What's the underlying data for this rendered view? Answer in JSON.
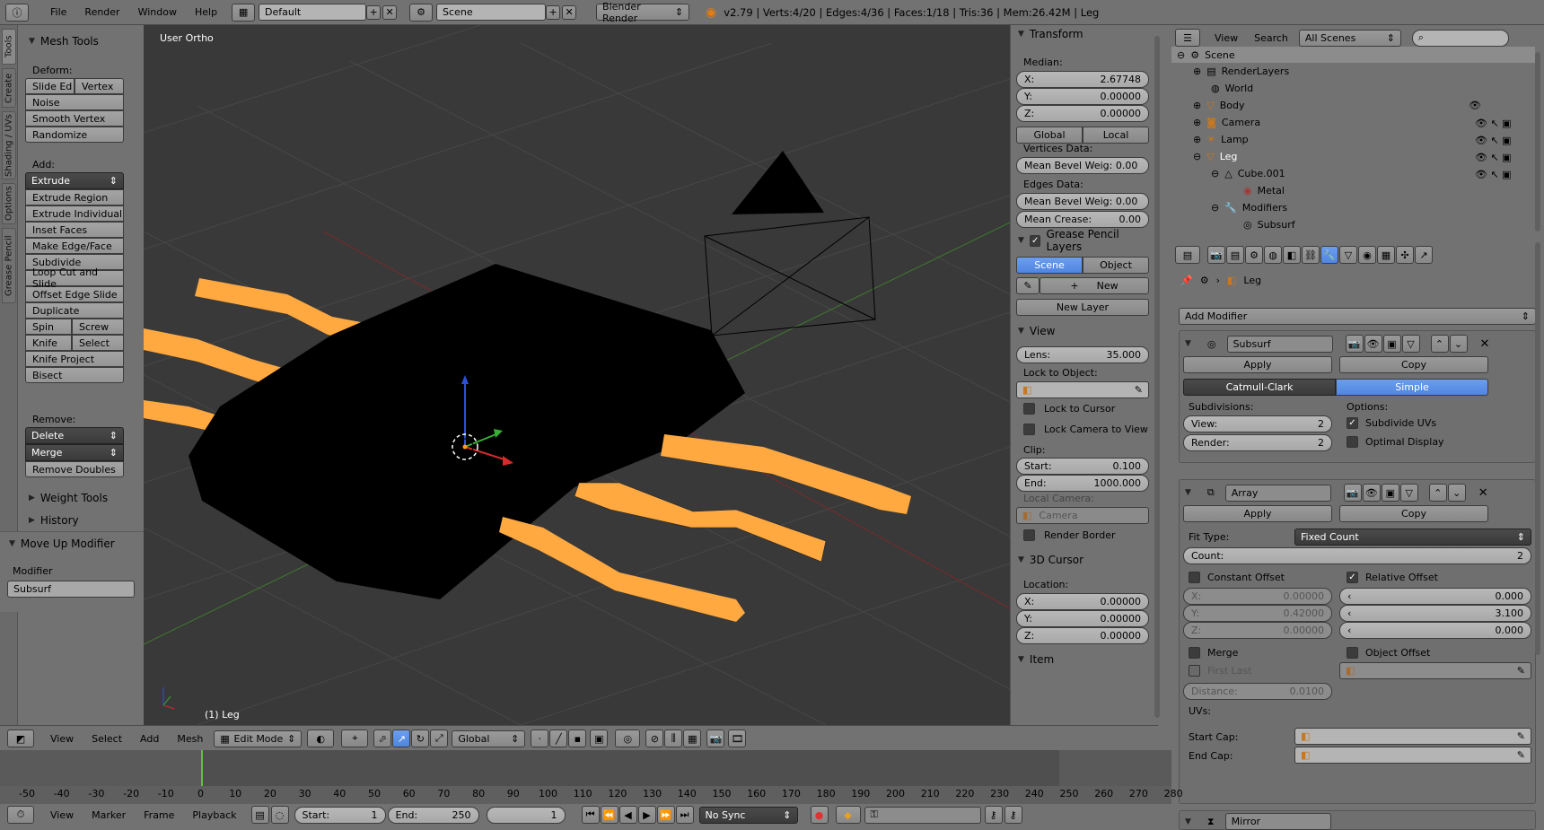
{
  "topbar": {
    "menus": [
      "File",
      "Render",
      "Window",
      "Help"
    ],
    "screen_layout": "Default",
    "scene": "Scene",
    "render_engine": "Blender Render",
    "stats": "v2.79 | Verts:4/20 | Edges:4/36 | Faces:1/18 | Tris:36 | Mem:26.42M | Leg"
  },
  "tabs": [
    "Tools",
    "Create",
    "Shading / UVs",
    "Options",
    "Grease Pencil"
  ],
  "tools": {
    "title": "Mesh Tools",
    "deform_label": "Deform:",
    "slide_edge": "Slide Ed",
    "vertex": "Vertex",
    "noise": "Noise",
    "smooth_vertex": "Smooth Vertex",
    "randomize": "Randomize",
    "add_label": "Add:",
    "extrude": "Extrude",
    "extrude_region": "Extrude Region",
    "extrude_individual": "Extrude Individual",
    "inset_faces": "Inset Faces",
    "make_edge_face": "Make Edge/Face",
    "subdivide": "Subdivide",
    "loop_cut": "Loop Cut and Slide",
    "offset_edge": "Offset Edge Slide",
    "duplicate": "Duplicate",
    "spin": "Spin",
    "screw": "Screw",
    "knife": "Knife",
    "select": "Select",
    "knife_project": "Knife Project",
    "bisect": "Bisect",
    "remove_label": "Remove:",
    "delete": "Delete",
    "merge": "Merge",
    "remove_doubles": "Remove Doubles",
    "weight_tools": "Weight Tools",
    "history": "History",
    "last_op": "Move Up Modifier",
    "modifier_label": "Modifier",
    "modifier_value": "Subsurf"
  },
  "viewport": {
    "view_label": "User Ortho",
    "object_label": "(1) Leg"
  },
  "npanel": {
    "transform": "Transform",
    "median": "Median:",
    "x_label": "X:",
    "x": "2.67748",
    "y_label": "Y:",
    "y": "0.00000",
    "z_label": "Z:",
    "z": "0.00000",
    "global": "Global",
    "local": "Local",
    "vertices_data": "Vertices Data:",
    "mean_bevel_v": "Mean Bevel Weig: 0.00",
    "edges_data": "Edges Data:",
    "mean_bevel_e": "Mean Bevel Weig: 0.00",
    "mean_crease_label": "Mean Crease:",
    "mean_crease": "0.00",
    "grease_pencil": "Grease Pencil Layers",
    "scene": "Scene",
    "object": "Object",
    "new": "New",
    "new_layer": "New Layer",
    "view": "View",
    "lens_label": "Lens:",
    "lens": "35.000",
    "lock_to_object": "Lock to Object:",
    "lock_to_cursor": "Lock to Cursor",
    "lock_camera": "Lock Camera to View",
    "clip": "Clip:",
    "start_label": "Start:",
    "start": "0.100",
    "end_label": "End:",
    "end": "1000.000",
    "local_camera": "Local Camera:",
    "camera": "Camera",
    "render_border": "Render Border",
    "cursor": "3D Cursor",
    "location": "Location:",
    "cx": "0.00000",
    "cy": "0.00000",
    "cz": "0.00000",
    "item": "Item"
  },
  "outliner": {
    "view": "View",
    "search": "Search",
    "filter": "All Scenes",
    "rows": [
      {
        "label": "Scene"
      },
      {
        "label": "RenderLayers"
      },
      {
        "label": "World"
      },
      {
        "label": "Body"
      },
      {
        "label": "Camera"
      },
      {
        "label": "Lamp"
      },
      {
        "label": "Leg"
      },
      {
        "label": "Cube.001"
      },
      {
        "label": "Metal"
      },
      {
        "label": "Modifiers"
      },
      {
        "label": "Subsurf"
      }
    ]
  },
  "properties": {
    "object_name": "Leg",
    "add_modifier": "Add Modifier",
    "subsurf": {
      "name": "Subsurf",
      "apply": "Apply",
      "copy": "Copy",
      "catmull": "Catmull-Clark",
      "simple": "Simple",
      "subdivisions": "Subdivisions:",
      "view_label": "View:",
      "view": "2",
      "render_label": "Render:",
      "render": "2",
      "options": "Options:",
      "subdivide_uvs": "Subdivide UVs",
      "optimal_display": "Optimal Display"
    },
    "array": {
      "name": "Array",
      "apply": "Apply",
      "copy": "Copy",
      "fit_type_label": "Fit Type:",
      "fit_type": "Fixed Count",
      "count_label": "Count:",
      "count": "2",
      "constant_offset": "Constant Offset",
      "relative_offset": "Relative Offset",
      "cx_label": "X:",
      "cx": "0.00000",
      "cy_label": "Y:",
      "cy": "0.42000",
      "cz_label": "Z:",
      "cz": "0.00000",
      "rx": "0.000",
      "ry": "3.100",
      "rz": "0.000",
      "merge": "Merge",
      "object_offset": "Object Offset",
      "first_last": "First Last",
      "distance_label": "Distance:",
      "distance": "0.0100",
      "uvs": "UVs:",
      "start_cap": "Start Cap:",
      "end_cap": "End Cap:"
    },
    "mirror": "Mirror"
  },
  "vpheader": {
    "view": "View",
    "select": "Select",
    "add": "Add",
    "mesh": "Mesh",
    "mode": "Edit Mode",
    "orientation": "Global"
  },
  "timeline": {
    "ticks": [
      "-50",
      "-40",
      "-30",
      "-20",
      "-10",
      "0",
      "10",
      "20",
      "30",
      "40",
      "50",
      "60",
      "70",
      "80",
      "90",
      "100",
      "110",
      "120",
      "130",
      "140",
      "150",
      "160",
      "170",
      "180",
      "190",
      "200",
      "210",
      "220",
      "230",
      "240",
      "250",
      "260",
      "270",
      "280"
    ],
    "view": "View",
    "marker": "Marker",
    "frame": "Frame",
    "playback": "Playback",
    "start_label": "Start:",
    "start": "1",
    "end_label": "End:",
    "end": "250",
    "current": "1",
    "sync": "No Sync"
  },
  "colors": {
    "accent": "#5680c2",
    "orange": "#ffa940",
    "bg_viewport": "#393939"
  }
}
